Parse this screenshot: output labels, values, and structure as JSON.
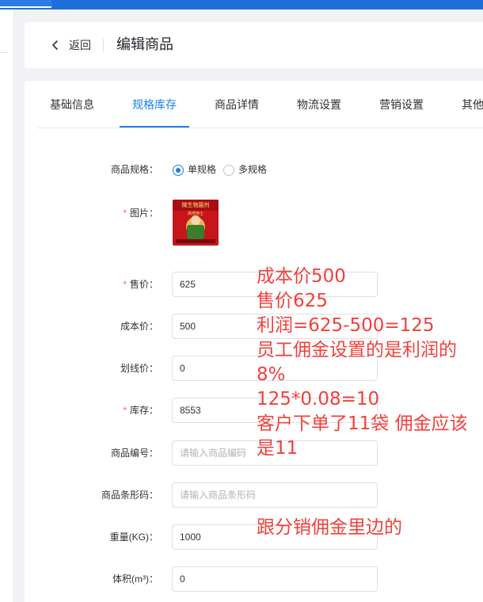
{
  "header": {
    "back_label": "返回",
    "title": "编辑商品"
  },
  "tabs": [
    {
      "label": "基础信息",
      "active": false
    },
    {
      "label": "规格库存",
      "active": true
    },
    {
      "label": "商品详情",
      "active": false
    },
    {
      "label": "物流设置",
      "active": false
    },
    {
      "label": "营销设置",
      "active": false
    },
    {
      "label": "其他",
      "active": false
    }
  ],
  "form": {
    "spec": {
      "label": "商品规格：",
      "options": [
        {
          "label": "单规格",
          "checked": true
        },
        {
          "label": "多规格",
          "checked": false
        }
      ]
    },
    "image": {
      "label": "图片：",
      "required": true,
      "image_text_top": "微生物菌剂",
      "image_text_sub": "高倍特士"
    },
    "price": {
      "label": "售价：",
      "required": true,
      "value": "625"
    },
    "cost": {
      "label": "成本价：",
      "required": false,
      "value": "500"
    },
    "original_price": {
      "label": "划线价：",
      "required": false,
      "value": "0"
    },
    "stock": {
      "label": "库存：",
      "required": true,
      "value": "8553"
    },
    "code": {
      "label": "商品编号：",
      "required": false,
      "placeholder": "请输入商品编码"
    },
    "barcode": {
      "label": "商品条形码：",
      "required": false,
      "placeholder": "请输入商品条形码"
    },
    "weight": {
      "label": "重量(KG)：",
      "required": false,
      "value": "1000"
    },
    "volume": {
      "label": "体积(m³)：",
      "required": false,
      "value": "0"
    }
  },
  "required_marker": "*",
  "annotation": {
    "lines": [
      "成本价500",
      "售价625",
      "利润=625-500=125",
      "员工佣金设置的是利润的",
      "8%",
      "125*0.08=10",
      "客户下单了11袋 佣金应该",
      "是11"
    ],
    "note": "跟分销佣金里边的"
  },
  "colors": {
    "accent": "#1b7fe8",
    "annotation": "#f0413c",
    "required": "#f56c6c"
  }
}
